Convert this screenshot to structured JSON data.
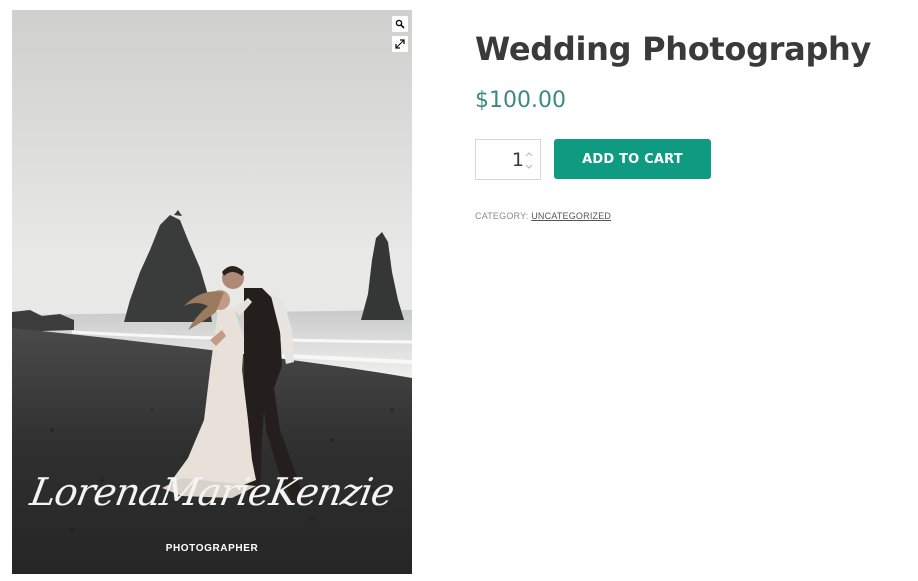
{
  "gallery": {
    "image_alt": "Couple embracing on a black sand beach",
    "signature": "LorenaMarieKenzie",
    "photographer_label": "PHOTOGRAPHER",
    "zoom_icon": "search-icon",
    "expand_icon": "expand-icon"
  },
  "product": {
    "title": "Wedding Photography",
    "price": "$100.00",
    "quantity_value": "1",
    "add_to_cart_label": "ADD TO CART",
    "category_label": "CATEGORY:",
    "category_value": "UNCATEGORIZED"
  },
  "colors": {
    "price": "#3b8a82",
    "button": "#0f9a82",
    "title": "#3a3a3a"
  }
}
